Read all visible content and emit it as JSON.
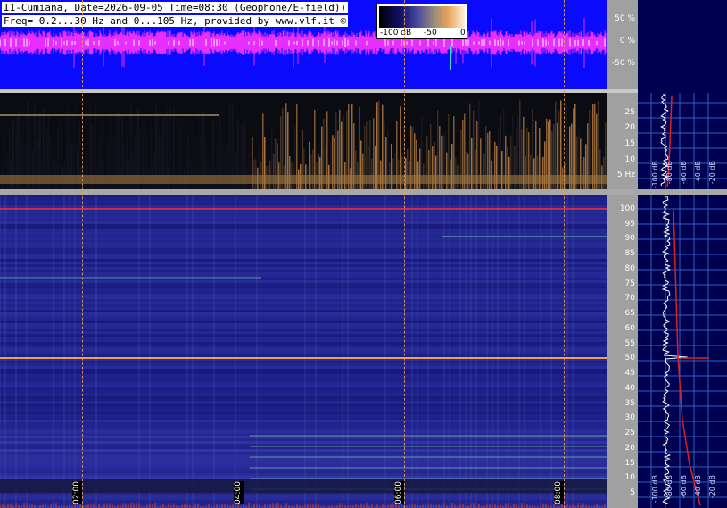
{
  "header": {
    "line1": "I1-Cumiana, Date=2026-09-05 Time=08:30 (Geophone/E-field))",
    "line2": "Freq= 0.2...30 Hz and 0...105 Hz, provided by www.vlf.it ©"
  },
  "colorbar": {
    "labels": [
      "-100 dB",
      "-50",
      "0"
    ]
  },
  "waveform_axis": {
    "ticks": [
      "50 %",
      "0 %",
      "-50 %"
    ]
  },
  "low_spectrogram_axis": {
    "ticks": [
      "25",
      "20",
      "15",
      "10",
      "5 Hz"
    ]
  },
  "high_spectrogram_axis": {
    "ticks": [
      "100",
      "95",
      "90",
      "85",
      "80",
      "75",
      "70",
      "65",
      "60",
      "55",
      "50",
      "45",
      "40",
      "35",
      "30",
      "25",
      "20",
      "15",
      "10",
      "5"
    ]
  },
  "time_markers": [
    "02:00",
    "04:00",
    "06:00",
    "08:00"
  ],
  "side_panel": {
    "low_scale_labels": [
      "-100 dB",
      "-80 dB",
      "-60 dB",
      "-40 dB",
      "-20 dB"
    ],
    "high_scale_labels": [
      "-100 dB",
      "-80 dB",
      "-60 dB",
      "-40 dB",
      "-20 dB"
    ]
  },
  "colors": {
    "waveform_bg": "#0a0afc",
    "waveform_trace": "#ff33ff",
    "marker_line": "#e8a060",
    "mains_line": "#ff3030"
  }
}
